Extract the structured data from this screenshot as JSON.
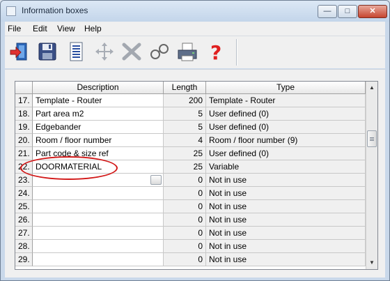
{
  "window": {
    "title": "Information boxes"
  },
  "menu": [
    "File",
    "Edit",
    "View",
    "Help"
  ],
  "toolbar": [
    "exit-icon",
    "save-icon",
    "list-icon",
    "move-icon",
    "delete-icon",
    "find-icon",
    "print-icon",
    "help-icon"
  ],
  "grid": {
    "headers": [
      "",
      "Description",
      "Length",
      "Type"
    ],
    "rows": [
      {
        "num": "17.",
        "desc": "Template - Router",
        "len": "200",
        "type": "Template - Router"
      },
      {
        "num": "18.",
        "desc": "Part area m2",
        "len": "5",
        "type": "User defined (0)"
      },
      {
        "num": "19.",
        "desc": "Edgebander",
        "len": "5",
        "type": "User defined (0)"
      },
      {
        "num": "20.",
        "desc": "Room / floor number",
        "len": "4",
        "type": "Room / floor number (9)"
      },
      {
        "num": "21.",
        "desc": "Part code & size ref",
        "len": "25",
        "type": "User defined (0)"
      },
      {
        "num": "22.",
        "desc": "DOORMATERIAL",
        "len": "25",
        "type": "Variable"
      },
      {
        "num": "23.",
        "desc": "",
        "len": "0",
        "type": "Not in use"
      },
      {
        "num": "24.",
        "desc": "",
        "len": "0",
        "type": "Not in use"
      },
      {
        "num": "25.",
        "desc": "",
        "len": "0",
        "type": "Not in use"
      },
      {
        "num": "26.",
        "desc": "",
        "len": "0",
        "type": "Not in use"
      },
      {
        "num": "27.",
        "desc": "",
        "len": "0",
        "type": "Not in use"
      },
      {
        "num": "28.",
        "desc": "",
        "len": "0",
        "type": "Not in use"
      },
      {
        "num": "29.",
        "desc": "",
        "len": "0",
        "type": "Not in use"
      }
    ]
  },
  "colors": {
    "highlight": "#d21818",
    "title_bg": "#c9d8ea"
  }
}
